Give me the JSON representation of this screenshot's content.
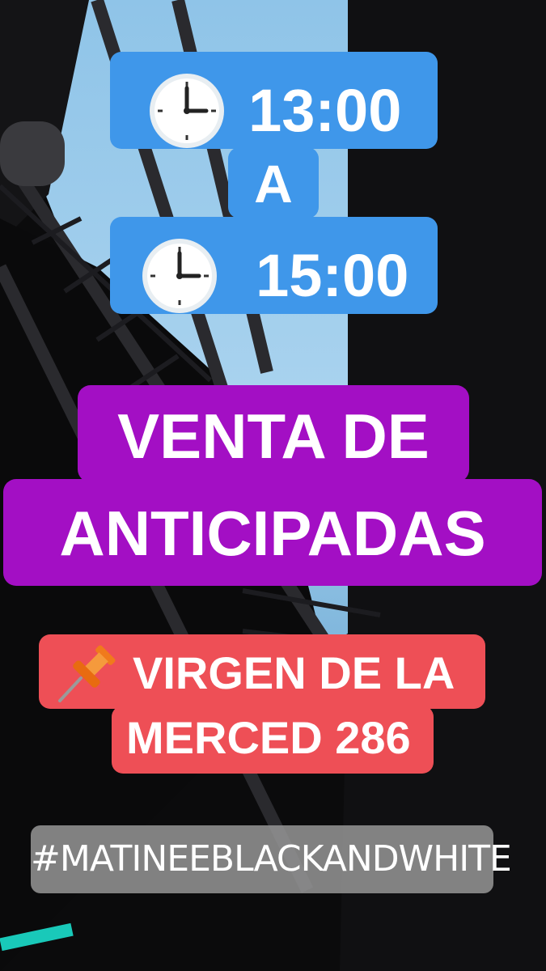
{
  "story": {
    "time_start": "13:00",
    "connector": "A",
    "time_end": "15:00",
    "headline_line1": "VENTA DE",
    "headline_line2": "ANTICIPADAS",
    "location_line1": "VIRGEN DE LA",
    "location_line2": "MERCED 286",
    "hashtag": "#MATINEEBLACKANDWHITE"
  },
  "icons": {
    "time_icon": "clock-three-oclock-icon",
    "location_icon": "pushpin-icon"
  },
  "colors": {
    "time_bg": "#3f97ea",
    "headline_bg": "#a30fc4",
    "location_bg": "#ee4f56",
    "hashtag_bg": "#969696"
  }
}
